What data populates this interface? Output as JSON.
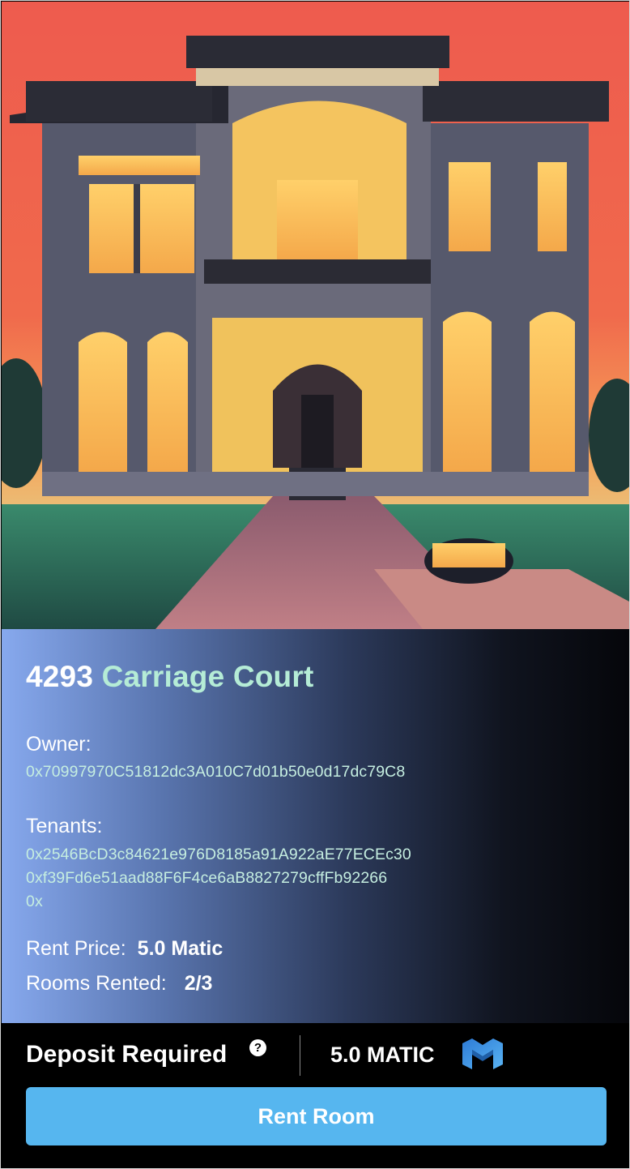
{
  "property": {
    "image_alt": "",
    "address_number": "4293",
    "address_street": "Carriage Court",
    "owner_label": "Owner:",
    "owner_address": "0x70997970C51812dc3A010C7d01b50e0d17dc79C8",
    "tenants_label": "Tenants:",
    "tenants": [
      "0x2546BcD3c84621e976D8185a91A922aE77ECEc30",
      "0xf39Fd6e51aad88F6F4ce6aB8827279cffFb92266",
      "0x"
    ],
    "rent_price_label": "Rent Price:",
    "rent_price_value": "5.0 Matic",
    "rooms_rented_label": "Rooms Rented:",
    "rooms_rented_value": "2/3"
  },
  "footer": {
    "deposit_label": "Deposit Required",
    "help_icon": "question-icon",
    "deposit_amount": "5.0 MATIC",
    "currency_icon": "matic-logo-icon",
    "rent_button_label": "Rent Room"
  },
  "colors": {
    "accent_button": "#56b6ef",
    "street_text": "#b5ecd6",
    "address_text": "#c5eee0"
  }
}
